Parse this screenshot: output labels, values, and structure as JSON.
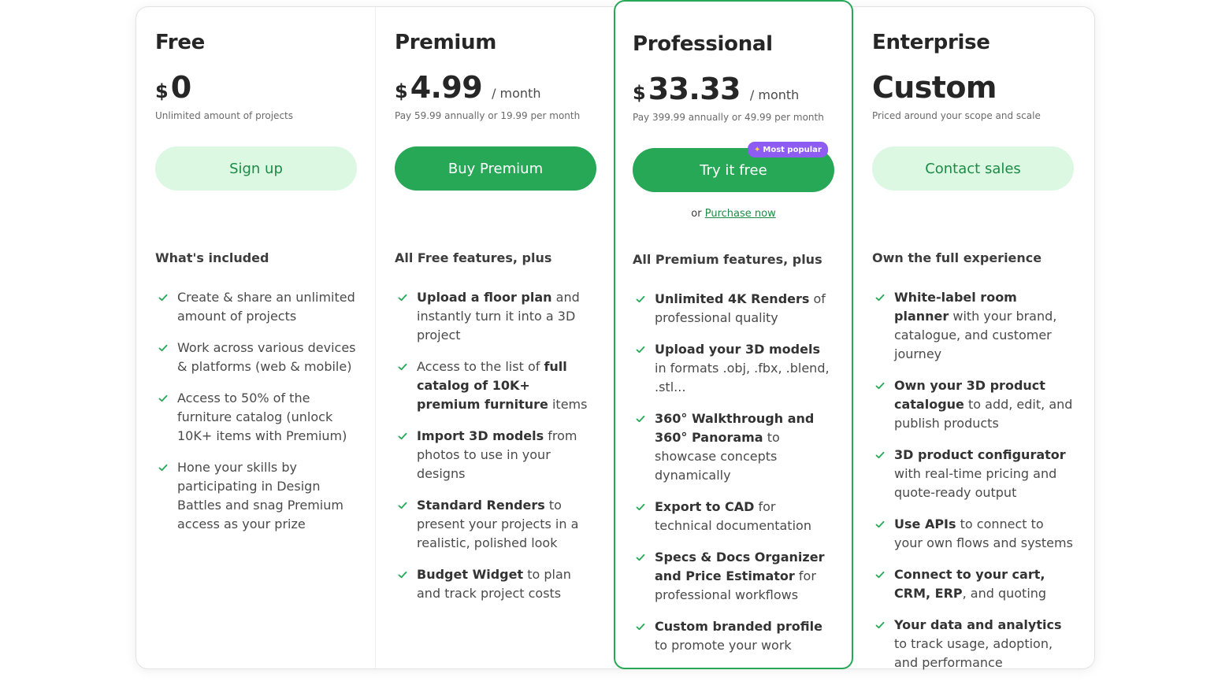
{
  "colors": {
    "accent": "#27a857",
    "accent_light": "#dcf8e3",
    "badge": "#8e5cf2"
  },
  "plans": [
    {
      "name": "Free",
      "currency": "$",
      "amount": "0",
      "period": "",
      "note": "Unlimited amount of projects",
      "button": "Sign up",
      "heading": "What's included",
      "features": [
        {
          "bold": "",
          "text": "Create & share an unlimited amount of projects"
        },
        {
          "bold": "",
          "text": "Work across various devices & platforms (web & mobile)"
        },
        {
          "bold": "",
          "text": "Access to 50% of the furniture catalog (unlock 10K+ items with Premium)"
        },
        {
          "bold": "",
          "text": "Hone your skills by participating in Design Battles and snag Premium access as your prize"
        }
      ]
    },
    {
      "name": "Premium",
      "currency": "$",
      "amount": "4.99",
      "period": "/  month",
      "note": "Pay 59.99 annually or 19.99 per month",
      "button": "Buy Premium",
      "heading": "All Free features, plus",
      "features": [
        {
          "bold": "Upload a floor plan",
          "text": " and instantly turn it into a 3D project"
        },
        {
          "pre": "Access to the list of ",
          "bold": "full catalog of 10K+ premium furniture",
          "text": " items"
        },
        {
          "bold": "Import 3D models",
          "text": " from photos to use in your designs"
        },
        {
          "bold": "Standard Renders",
          "text": " to present your projects in a realistic, polished look"
        },
        {
          "bold": "Budget Widget",
          "text": " to plan and track project costs"
        }
      ]
    },
    {
      "name": "Professional",
      "currency": "$",
      "amount": "33.33",
      "period": "/  month",
      "note": "Pay 399.99 annually or 49.99 per month",
      "button": "Try it free",
      "badge": "Most popular",
      "alt_prefix": "or",
      "alt_link": "Purchase now",
      "heading": "All Premium features, plus",
      "features": [
        {
          "bold": "Unlimited 4K Renders",
          "text": " of professional quality"
        },
        {
          "bold": "Upload your 3D models",
          "text": " in formats .obj, .fbx, .blend, .stl..."
        },
        {
          "bold": "360° Walkthrough and 360° Panorama",
          "text": " to showcase concepts dynamically"
        },
        {
          "bold": "Export to CAD",
          "text": " for technical documentation"
        },
        {
          "bold": "Specs & Docs Organizer and Price Estimator",
          "text": " for professional workflows"
        },
        {
          "bold": "Custom branded profile",
          "text": " to promote your work"
        }
      ]
    },
    {
      "name": "Enterprise",
      "custom": "Custom",
      "note": "Priced around your scope and scale",
      "button": "Contact sales",
      "heading": "Own the full experience",
      "features": [
        {
          "bold": "White-label room planner",
          "text": " with your brand, catalogue, and customer journey"
        },
        {
          "bold": "Own your 3D product catalogue",
          "text": " to add, edit, and publish products"
        },
        {
          "bold": "3D product configurator",
          "text": " with real-time pricing and quote-ready output"
        },
        {
          "bold": "Use APIs",
          "text": " to connect to your own flows and systems"
        },
        {
          "bold": "Connect to your cart, CRM, ERP",
          "text": ", and quoting"
        },
        {
          "bold": "Your data and analytics",
          "text": " to track usage, adoption, and performance"
        }
      ]
    }
  ]
}
